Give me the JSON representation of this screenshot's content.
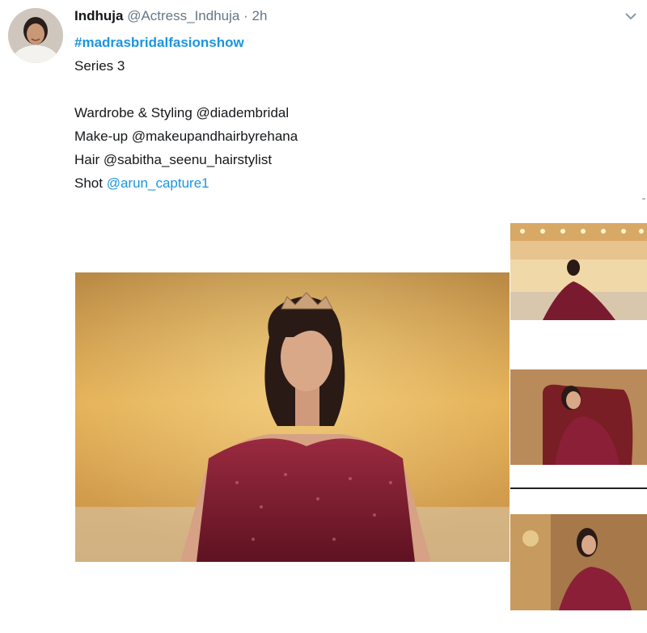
{
  "tweet": {
    "author_name": "Indhuja",
    "author_handle": "@Actress_Indhuja",
    "separator": "·",
    "timestamp": "2h",
    "lines": {
      "hashtag": "#madrasbridalfasionshow",
      "series": "Series 3",
      "wardrobe": "Wardrobe & Styling  @diadembridal",
      "makeup": "Make-up @makeupandhairbyrehana",
      "hair": "Hair @sabitha_seenu_hairstylist",
      "shot_label": "Shot ",
      "shot_handle": "@arun_capture1"
    }
  },
  "icons": {
    "avatar": "avatar",
    "more": "chevron-down-icon"
  },
  "colors": {
    "link": "#1b95e0",
    "muted": "#657786",
    "gown": "#7a1a2e",
    "background_warm": "#e0a84a"
  }
}
